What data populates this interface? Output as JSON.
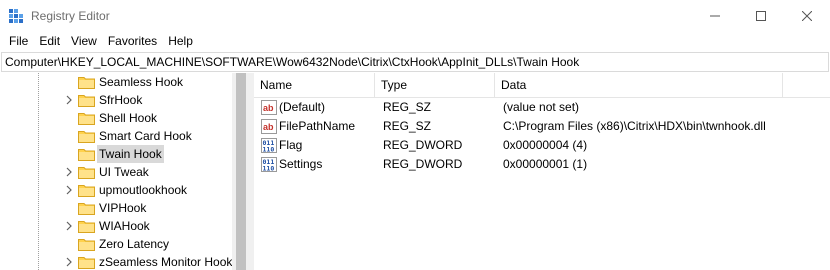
{
  "window": {
    "title": "Registry Editor"
  },
  "menu": [
    "File",
    "Edit",
    "View",
    "Favorites",
    "Help"
  ],
  "address": "Computer\\HKEY_LOCAL_MACHINE\\SOFTWARE\\Wow6432Node\\Citrix\\CtxHook\\AppInit_DLLs\\Twain Hook",
  "tree": [
    {
      "label": "Seamless Hook",
      "expandable": false,
      "selected": false
    },
    {
      "label": "SfrHook",
      "expandable": true,
      "selected": false
    },
    {
      "label": "Shell Hook",
      "expandable": false,
      "selected": false
    },
    {
      "label": "Smart Card Hook",
      "expandable": false,
      "selected": false
    },
    {
      "label": "Twain Hook",
      "expandable": false,
      "selected": true
    },
    {
      "label": "UI Tweak",
      "expandable": true,
      "selected": false
    },
    {
      "label": "upmoutlookhook",
      "expandable": true,
      "selected": false
    },
    {
      "label": "VIPHook",
      "expandable": false,
      "selected": false
    },
    {
      "label": "WIAHook",
      "expandable": true,
      "selected": false
    },
    {
      "label": "Zero Latency",
      "expandable": false,
      "selected": false
    },
    {
      "label": "zSeamless Monitor Hook",
      "expandable": true,
      "selected": false
    }
  ],
  "columns": {
    "name": "Name",
    "type": "Type",
    "data": "Data"
  },
  "values": [
    {
      "name": "(Default)",
      "type": "REG_SZ",
      "data": "(value not set)",
      "icon": "string-value-icon"
    },
    {
      "name": "FilePathName",
      "type": "REG_SZ",
      "data": "C:\\Program Files (x86)\\Citrix\\HDX\\bin\\twnhook.dll",
      "icon": "string-value-icon"
    },
    {
      "name": "Flag",
      "type": "REG_DWORD",
      "data": "0x00000004 (4)",
      "icon": "binary-value-icon"
    },
    {
      "name": "Settings",
      "type": "REG_DWORD",
      "data": "0x00000001 (1)",
      "icon": "binary-value-icon"
    }
  ],
  "colors": {
    "folder": "#ffd24d",
    "selection": "#d9d9d9",
    "string_icon": "#c4312b",
    "binary_icon": "#1d4ea3"
  }
}
